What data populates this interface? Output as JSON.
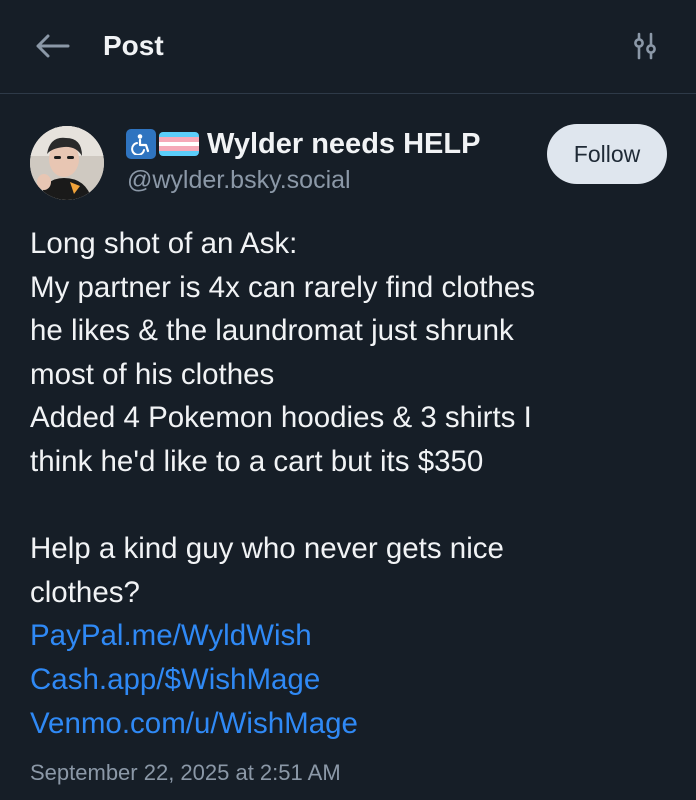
{
  "header": {
    "title": "Post",
    "back_icon": "arrow-left-icon",
    "filter_icon": "sliders-icon"
  },
  "author": {
    "display_name": "Wylder needs HELP",
    "handle": "@wylder.bsky.social",
    "badges": [
      "wheelchair-accessibility-emoji",
      "transgender-flag-emoji"
    ],
    "follow_label": "Follow"
  },
  "post": {
    "lines": [
      "Long shot of an Ask:",
      "My partner is 4x can rarely find clothes",
      "he likes & the laundromat just shrunk",
      "most of his clothes",
      "Added 4 Pokemon hoodies & 3 shirts I",
      "think he'd like to a cart but its $350"
    ],
    "help_lines": [
      "Help a kind guy who never gets nice",
      "clothes?"
    ],
    "links": [
      "PayPal.me/WyldWish",
      "Cash.app/$WishMage",
      "Venmo.com/u/WishMage"
    ],
    "timestamp": "September 22, 2025 at 2:51 AM"
  },
  "colors": {
    "background": "#161e27",
    "link": "#2f89f5",
    "muted": "#8b98a7",
    "follow_bg": "#dfe6ee"
  }
}
